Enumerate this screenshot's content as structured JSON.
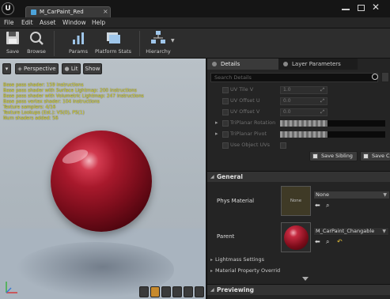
{
  "window": {
    "doc_tab": "M_CarPaint_Red"
  },
  "menu": [
    "File",
    "Edit",
    "Asset",
    "Window",
    "Help"
  ],
  "toolbar": {
    "save": "Save",
    "browse": "Browse",
    "params": "Params",
    "platform_stats": "Platform Stats",
    "hierarchy": "Hierarchy"
  },
  "viewport": {
    "perspective": "Perspective",
    "lit": "Lit",
    "show": "Show",
    "stats": [
      "Base pass shader: 159 instructions",
      "Base pass shader with Surface Lightmap: 200 instructions",
      "Base pass shader with Volumetric Lightmap: 247 instructions",
      "Base pass vertex shader: 104 instructions",
      "Texture samplers: 4/16",
      "Texture Lookups (Est.): VS(0), PS(1)",
      "Num shaders added: 56"
    ]
  },
  "panel": {
    "tabs": [
      "Details",
      "Layer Parameters"
    ],
    "search_placeholder": "Search Details",
    "rows": [
      {
        "label": "UV Tile V",
        "value": "1.0"
      },
      {
        "label": "UV Offset U",
        "value": "0.0"
      },
      {
        "label": "UV Offset V",
        "value": "0.0"
      },
      {
        "label": "TriPlanar Rotation"
      },
      {
        "label": "TriPlanar Pivot"
      },
      {
        "label": "Use Object UVs"
      }
    ],
    "save_sibling": "Save Sibling",
    "save_child": "Save C",
    "general": {
      "title": "General",
      "phys_material_label": "Phys Material",
      "phys_material_thumb": "None",
      "phys_material_value": "None",
      "parent_label": "Parent",
      "parent_value": "M_CarPaint_Changable"
    },
    "subsections": [
      "Lightmass Settings",
      "Material Property Overrid"
    ],
    "previewing": "Previewing"
  },
  "colors": {
    "stats_text": "#e6e02a",
    "accent_blue": "#4da4db",
    "active_tool": "#c78a2d",
    "paint_red": "#a8192c"
  }
}
